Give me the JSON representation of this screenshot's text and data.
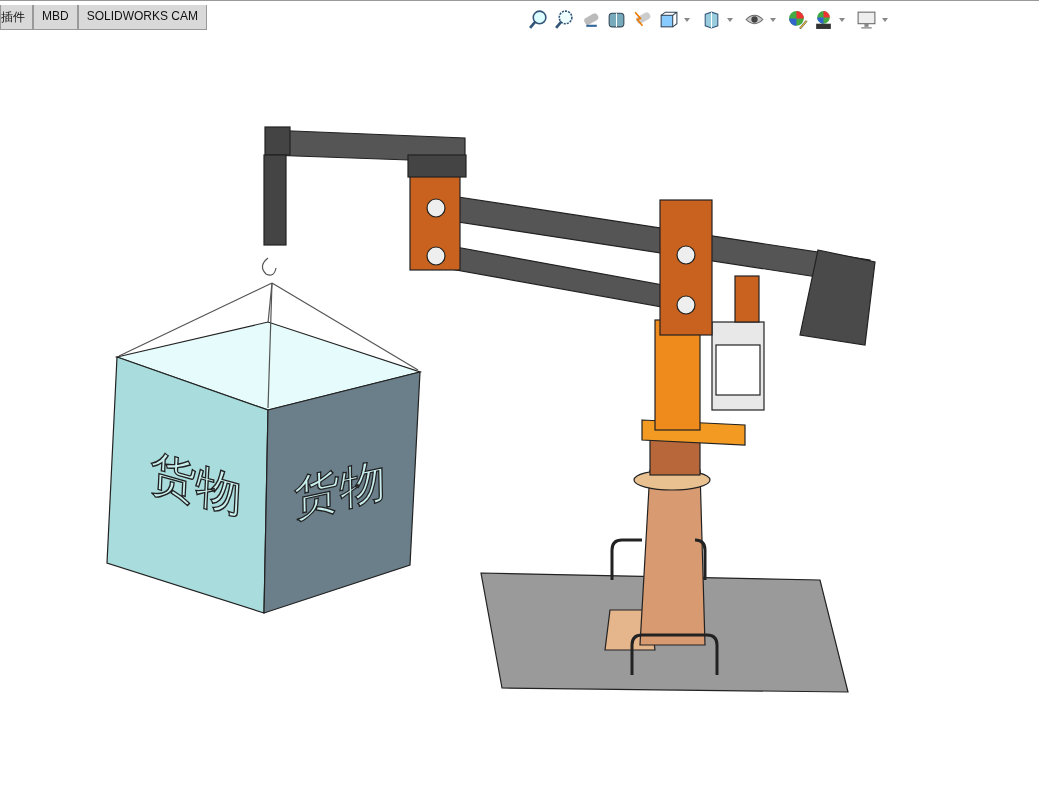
{
  "tabs": [
    {
      "label": "插件"
    },
    {
      "label": "MBD"
    },
    {
      "label": "SOLIDWORKS CAM"
    }
  ],
  "viewport": {
    "cargo_labels": [
      "货物",
      "货物"
    ]
  }
}
